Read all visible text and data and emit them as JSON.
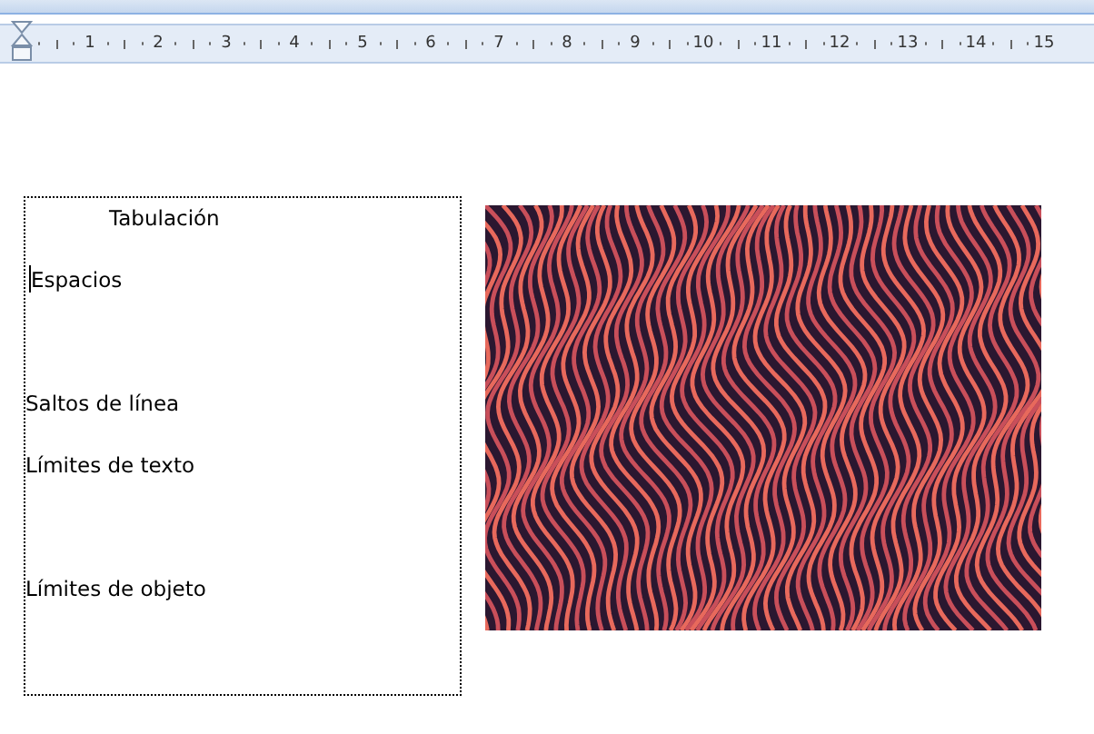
{
  "ruler": {
    "numbers": [
      "1",
      "2",
      "3",
      "4",
      "5",
      "6",
      "7",
      "8",
      "9",
      "10",
      "11",
      "12",
      "13",
      "14",
      "15"
    ]
  },
  "text_box": {
    "lines": [
      {
        "text": "Tabulación",
        "kind": "tabbed"
      },
      {
        "text": "Espacios",
        "kind": "caret"
      },
      {
        "text": "Saltos de línea",
        "kind": "plain"
      },
      {
        "text": "Límites de texto",
        "kind": "plain"
      },
      {
        "text": "Límites de objeto",
        "kind": "plain"
      }
    ]
  }
}
